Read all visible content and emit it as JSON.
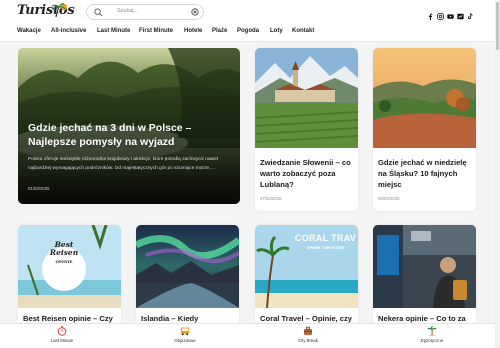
{
  "header": {
    "logo_text": "Turistos",
    "search": {
      "placeholder": "Szukaj..."
    },
    "social_icons": [
      "facebook-icon",
      "instagram-icon",
      "youtube-icon",
      "pinterest-icon",
      "tiktok-icon"
    ]
  },
  "nav": {
    "items": [
      {
        "label": "Wakacje"
      },
      {
        "label": "All-inclusive"
      },
      {
        "label": "Last Minute"
      },
      {
        "label": "First Minute"
      },
      {
        "label": "Hotele"
      },
      {
        "label": "Plaże"
      },
      {
        "label": "Pogoda"
      },
      {
        "label": "Loty"
      },
      {
        "label": "Kontakt"
      }
    ]
  },
  "featured": {
    "title": "Gdzie jechać na 3 dni w Polsce – Najlepsze pomysły na wyjazd",
    "excerpt": "Polska oferuje niezwykłe różnorodne krajobrazy i atrakcje, które potrafią zachwycić nawet najbardziej wymagających podróżników. Od majestatycznych gór po szumiące morze,…",
    "date": "01/03/2025"
  },
  "cards_top": [
    {
      "title": "Zwiedzanie Słowenii – co warto zobaczyć poza Lublaną?",
      "date": "27/02/2025"
    },
    {
      "title": "Gdzie jechać w niedzielę na Śląsku? 10 fajnych miejsc",
      "date": "09/02/2025"
    }
  ],
  "cards_bottom": [
    {
      "title": "Best Reisen opinie – Czy",
      "badge_line1": "Best",
      "badge_line2": "Reisen",
      "badge_line3": "OPINIE"
    },
    {
      "title": "Islandia – Kiedy"
    },
    {
      "title": "Coral Travel – Opinie, czy",
      "overlay_line1": "CORAL TRAV",
      "overlay_line2": "OPINIE TURYSTÓW"
    },
    {
      "title": "Nekera opinie – Co to za"
    }
  ],
  "bottom_bar": [
    {
      "label": "Last Minute",
      "icon": "stopwatch-icon"
    },
    {
      "label": "Objazdowe",
      "icon": "bus-icon"
    },
    {
      "label": "City Break",
      "icon": "suitcase-icon"
    },
    {
      "label": "Egzotyczne",
      "icon": "palm-icon"
    }
  ],
  "colors": {
    "accent": "#e8402f",
    "nav_text": "#222222",
    "card_bg": "#ffffff"
  }
}
